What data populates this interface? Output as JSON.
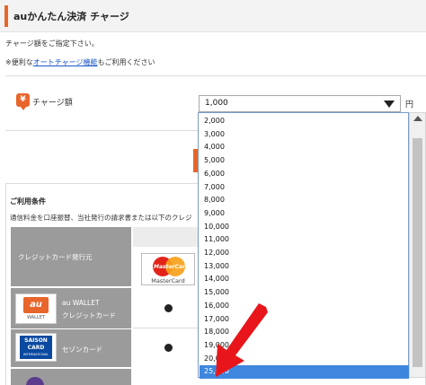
{
  "header": {
    "title": "auかんたん決済 チャージ"
  },
  "intro": {
    "instruction": "チャージ額をご指定下さい。",
    "note_prefix": "※便利な",
    "note_link": "オートチャージ機能",
    "note_suffix": "もご利用ください"
  },
  "charge": {
    "icon": "yen-icon",
    "label": "チャージ額",
    "selected_value": "1,000",
    "unit": "円"
  },
  "dropdown": {
    "options": [
      "2,000",
      "3,000",
      "4,000",
      "5,000",
      "6,000",
      "7,000",
      "8,000",
      "9,000",
      "10,000",
      "11,000",
      "12,000",
      "13,000",
      "14,000",
      "15,000",
      "16,000",
      "17,000",
      "18,000",
      "19,000",
      "20,000",
      "25,000"
    ],
    "highlighted": "25,000"
  },
  "conditions": {
    "title": "ご利用条件",
    "description": "通信料金を口座振替、当社発行の請求書または以下のクレジ",
    "issuer_header": "クレジットカード発行元",
    "mastercard_caption": "MasterCard",
    "mastercard_word": "MasterCard",
    "rows": [
      {
        "name": "au WALLET\nクレジットカード",
        "line1": "au WALLET",
        "line2": "クレジットカード",
        "logo": "au-wallet-logo",
        "logo_mark": "au",
        "logo_sub": "WALLET",
        "supported": true
      },
      {
        "name": "セゾンカード",
        "logo": "saison-card-logo",
        "logo_t1": "SAISON",
        "logo_t2": "CARD",
        "logo_t3": "INTERNATIONAL",
        "supported": true
      }
    ]
  },
  "colors": {
    "accent": "#e8652b",
    "selection": "#3f86de",
    "table_grey": "#9b9b9b",
    "annotation_arrow": "#e8161b",
    "link": "#1a56c4"
  }
}
